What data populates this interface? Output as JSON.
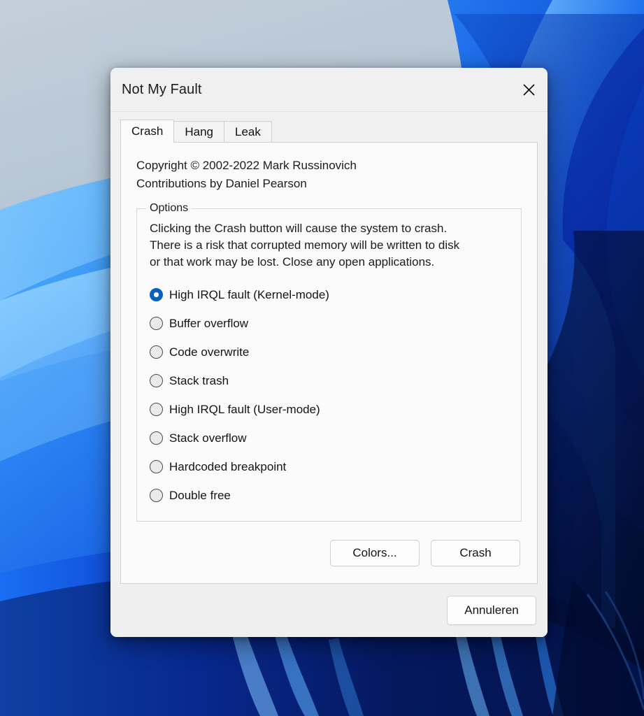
{
  "desktop": {
    "wallpaper_name": "windows-11-bloom-wallpaper",
    "colors": {
      "sky": "#b9c8d6",
      "ribbon_light": "#4ea8f5",
      "ribbon_mid": "#1470ef",
      "ribbon_deep": "#0a2db5",
      "ribbon_dark": "#061a5e",
      "ribbon_darkest": "#020b33"
    }
  },
  "dialog": {
    "title": "Not My Fault",
    "close_icon": "close-icon",
    "tabs": [
      {
        "label": "Crash",
        "active": true
      },
      {
        "label": "Hang",
        "active": false
      },
      {
        "label": "Leak",
        "active": false
      }
    ],
    "copyright": {
      "line1": "Copyright © 2002-2022 Mark Russinovich",
      "line2": "Contributions by Daniel Pearson"
    },
    "options_group": {
      "legend": "Options",
      "description": [
        "Clicking the Crash button will cause the system to crash.",
        "There is a risk that corrupted memory will be written to disk",
        "or that work may be lost. Close any open applications."
      ],
      "radios": [
        {
          "label": "High IRQL fault (Kernel-mode)",
          "checked": true
        },
        {
          "label": "Buffer overflow",
          "checked": false
        },
        {
          "label": "Code overwrite",
          "checked": false
        },
        {
          "label": "Stack trash",
          "checked": false
        },
        {
          "label": "High IRQL fault (User-mode)",
          "checked": false
        },
        {
          "label": "Stack overflow",
          "checked": false
        },
        {
          "label": "Hardcoded breakpoint",
          "checked": false
        },
        {
          "label": "Double free",
          "checked": false
        }
      ]
    },
    "buttons": {
      "colors": "Colors...",
      "crash": "Crash",
      "cancel": "Annuleren"
    },
    "accent_color": "#0b5fc4"
  }
}
